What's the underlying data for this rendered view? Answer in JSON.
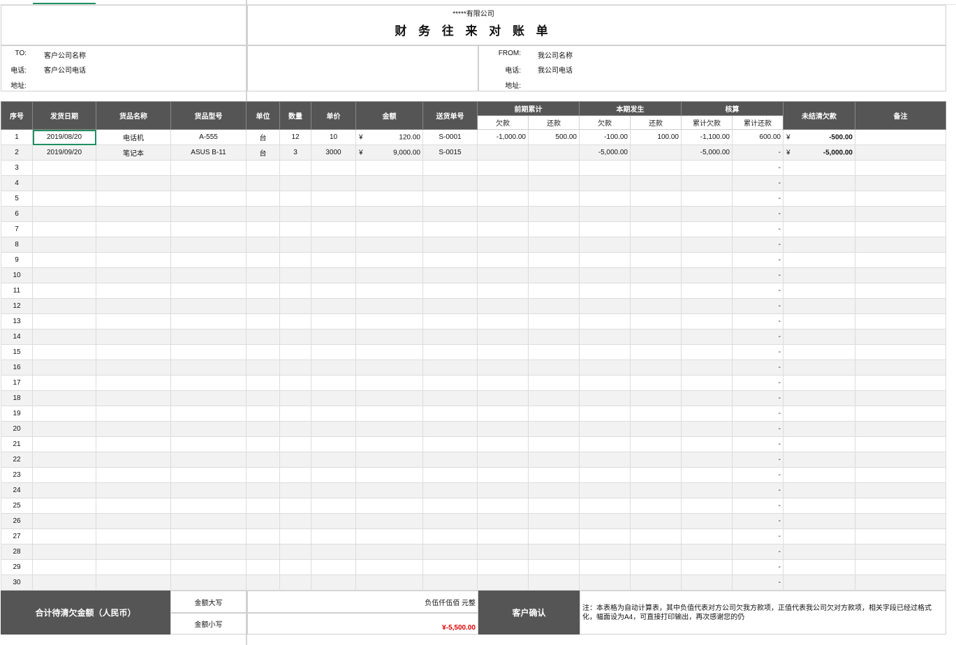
{
  "header": {
    "company": "*****有限公司",
    "title": "财 务 往 来 对 账 单"
  },
  "to": {
    "to_label": "TO:",
    "to_value": "客户公司名称",
    "phone_label": "电话:",
    "phone_value": "客户公司电话",
    "addr_label": "地址:"
  },
  "from": {
    "from_label": "FROM:",
    "from_value": "我公司名称",
    "phone_label": "电话:",
    "phone_value": "我公司电话",
    "addr_label": "地址:"
  },
  "columns": {
    "seq": "序号",
    "date": "发货日期",
    "name": "货品名称",
    "model": "货品型号",
    "unit": "单位",
    "qty": "数量",
    "price": "单价",
    "amount": "金额",
    "delivery_no": "送货单号",
    "prev": "前期累计",
    "prev_owe": "欠款",
    "prev_pay": "还款",
    "cur": "本期发生",
    "cur_owe": "欠款",
    "cur_pay": "还款",
    "check": "核算",
    "check_owe": "累计欠款",
    "check_pay": "累计还款",
    "outstanding": "未结清欠款",
    "remark": "备注"
  },
  "currency_symbol": "¥",
  "rows": [
    {
      "seq": "1",
      "date": "2019/08/20",
      "name": "电话机",
      "model": "A-555",
      "unit": "台",
      "qty": "12",
      "price": "10",
      "amount": "120.00",
      "delivery_no": "S-0001",
      "prev_owe": "-1,000.00",
      "prev_pay": "500.00",
      "cur_owe": "-100.00",
      "cur_pay": "100.00",
      "check_owe": "-1,100.00",
      "check_pay": "600.00",
      "outstanding": "-500.00"
    },
    {
      "seq": "2",
      "date": "2019/09/20",
      "name": "笔记本",
      "model": "ASUS B-11",
      "unit": "台",
      "qty": "3",
      "price": "3000",
      "amount": "9,000.00",
      "delivery_no": "S-0015",
      "prev_owe": "",
      "prev_pay": "",
      "cur_owe": "-5,000.00",
      "cur_pay": "",
      "check_owe": "-5,000.00",
      "check_pay": "-",
      "outstanding": "-5,000.00"
    },
    {
      "seq": "3",
      "check_pay": "-"
    },
    {
      "seq": "4",
      "check_pay": "-"
    },
    {
      "seq": "5",
      "check_pay": "-"
    },
    {
      "seq": "6",
      "check_pay": "-"
    },
    {
      "seq": "7",
      "check_pay": "-"
    },
    {
      "seq": "8",
      "check_pay": "-"
    },
    {
      "seq": "9",
      "check_pay": "-"
    },
    {
      "seq": "10",
      "check_pay": "-"
    },
    {
      "seq": "11",
      "check_pay": "-"
    },
    {
      "seq": "12",
      "check_pay": "-"
    },
    {
      "seq": "13",
      "check_pay": "-"
    },
    {
      "seq": "14",
      "check_pay": "-"
    },
    {
      "seq": "15",
      "check_pay": "-"
    },
    {
      "seq": "16",
      "check_pay": "-"
    },
    {
      "seq": "17",
      "check_pay": "-"
    },
    {
      "seq": "18",
      "check_pay": "-"
    },
    {
      "seq": "19",
      "check_pay": "-"
    },
    {
      "seq": "20",
      "check_pay": "-"
    },
    {
      "seq": "21",
      "check_pay": "-"
    },
    {
      "seq": "22",
      "check_pay": "-"
    },
    {
      "seq": "23",
      "check_pay": "-"
    },
    {
      "seq": "24",
      "check_pay": "-"
    },
    {
      "seq": "25",
      "check_pay": "-"
    },
    {
      "seq": "26",
      "check_pay": "-"
    },
    {
      "seq": "27",
      "check_pay": "-"
    },
    {
      "seq": "28",
      "check_pay": "-"
    },
    {
      "seq": "29",
      "check_pay": "-"
    },
    {
      "seq": "30",
      "check_pay": "-"
    }
  ],
  "footer": {
    "total_label": "合计待清欠金额（人民币）",
    "upper_label": "金额大写",
    "lower_label": "金额小写",
    "upper_value": "负伍仟伍佰 元整",
    "lower_value": "¥-5,500.00",
    "confirm_label": "客户确认",
    "note": "注：本表格为自动计算表，其中负值代表对方公司欠我方款项，正值代表我公司欠对方款项，相关字段已经过格式化，幅面设为A4，可直接打印输出，再次感谢您的仍"
  },
  "colors": {
    "header_bg": "#555555",
    "selection": "#1f8f5f",
    "negative_total": "#e00000"
  }
}
